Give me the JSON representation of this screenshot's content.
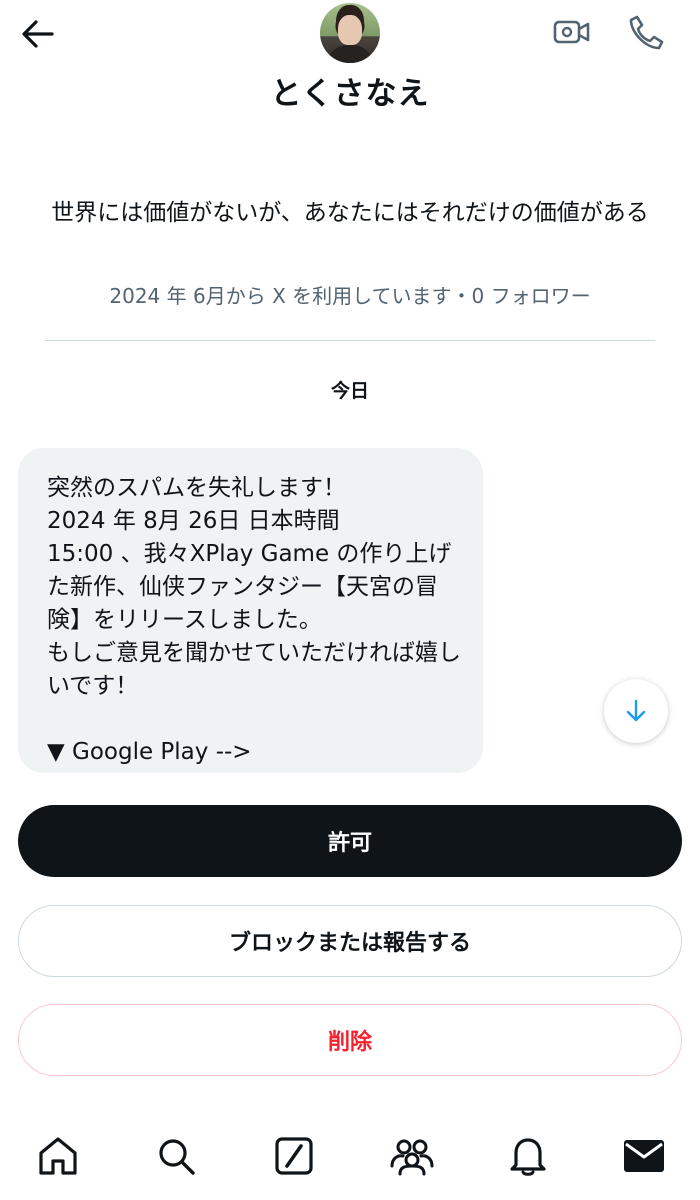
{
  "header": {
    "back_icon": "arrow-left-icon",
    "display_name": "とくさなえ",
    "video_icon": "video-call-icon",
    "call_icon": "phone-icon"
  },
  "profile": {
    "bio": "世界には価値がないが、あなたにはそれだけの価値がある",
    "meta": "2024 年 6月から X を利用しています・0 フォロワー"
  },
  "conversation": {
    "date_label": "今日",
    "message": "突然のスパムを失礼します！\n2024 年 8月 26日 日本時間\n15:00 、我々XPlay Game の作り上げた新作、仙侠ファンタジー【天宮の冒険】をリリースしました。\nもしご意見を聞かせていただければ嬉しいです！\n\n▼ Google Play -->"
  },
  "actions": {
    "accept_label": "許可",
    "block_label": "ブロックまたは報告する",
    "delete_label": "削除"
  },
  "nav": {
    "items": [
      "home-icon",
      "search-icon",
      "grok-icon",
      "communities-icon",
      "notifications-icon",
      "messages-icon"
    ]
  },
  "colors": {
    "text": "#0f1419",
    "secondary": "#536471",
    "bubble": "#eff3f4",
    "danger": "#f4212e",
    "accent": "#1d9bf0"
  }
}
